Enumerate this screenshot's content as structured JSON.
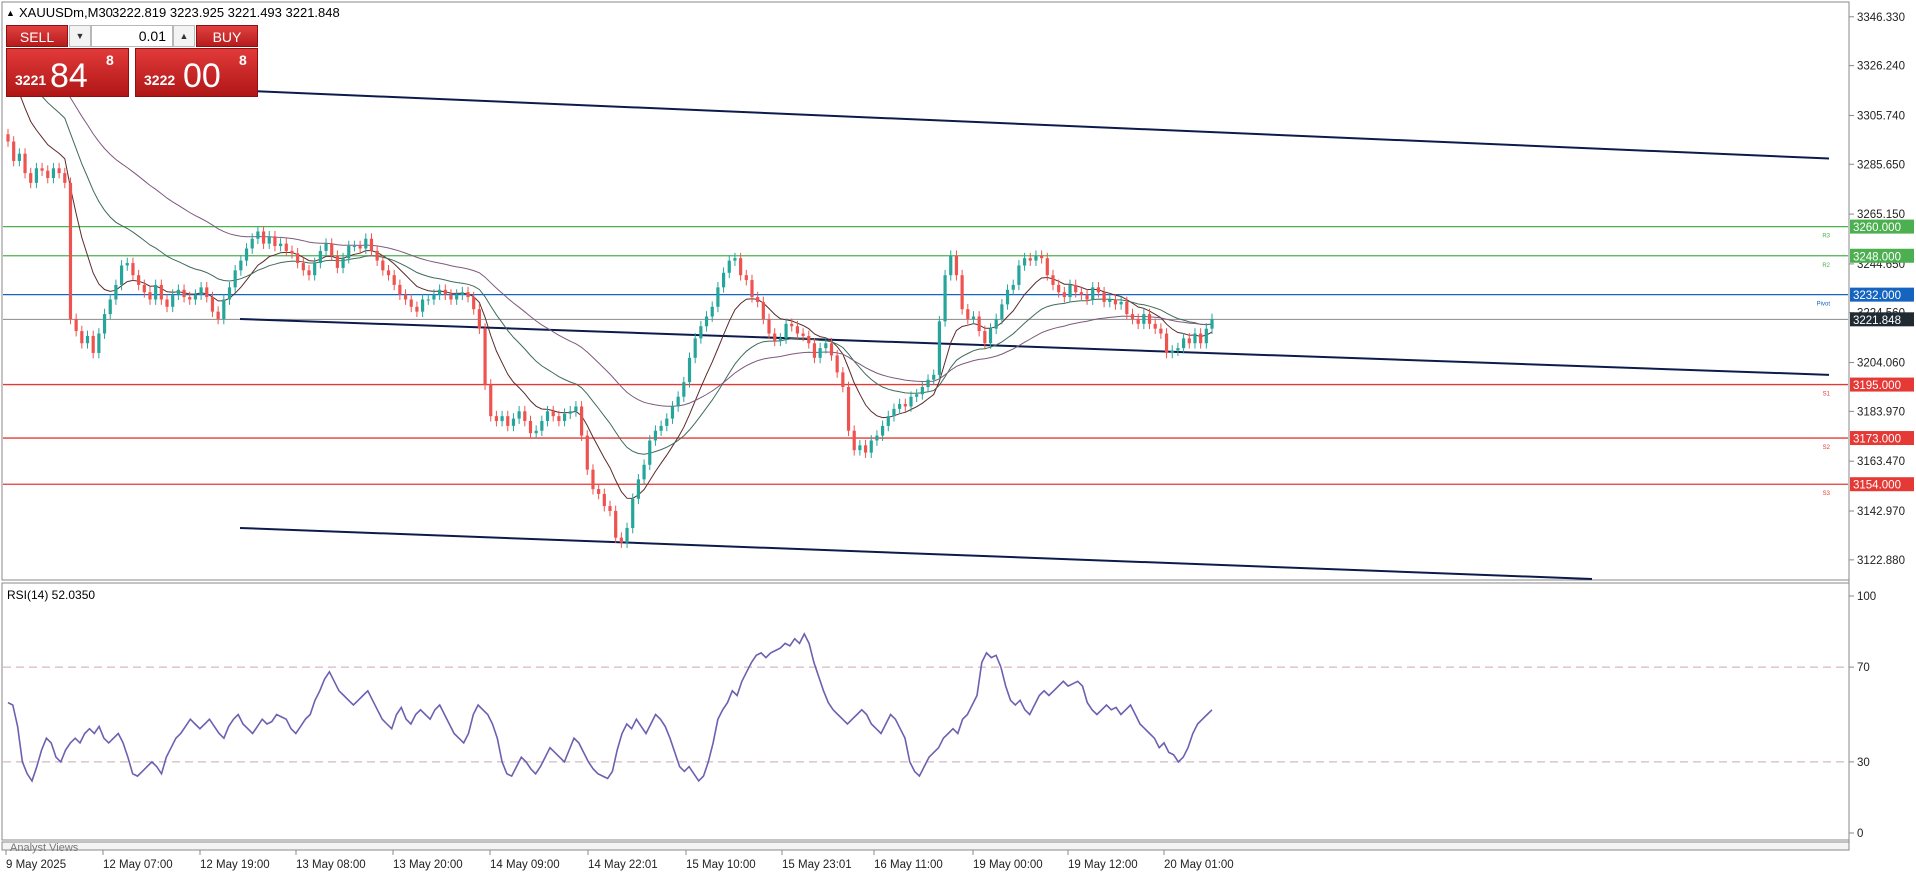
{
  "header": {
    "symbol_timeframe": "XAUUSDm,M30",
    "ohlc": "3222.819 3223.925 3221.493 3221.848"
  },
  "trade_panel": {
    "sell_label": "SELL",
    "buy_label": "BUY",
    "lot": "0.01",
    "sell_price_small": "3221",
    "sell_price_big": "84",
    "sell_price_sup": "8",
    "buy_price_small": "3222",
    "buy_price_big": "00",
    "buy_price_sup": "8"
  },
  "rsi_label": "RSI(14) 52.0350",
  "analyst_views_label": "Analyst Views",
  "colors": {
    "bull": "#26a69a",
    "bear": "#ef5350",
    "resistance": "#4caf50",
    "pivot": "#1565c0",
    "support": "#e53935",
    "channel": "#0d1b4c",
    "rsi": "#6e5fb0"
  },
  "chart_data": [
    {
      "type": "candlestick",
      "symbol": "XAUUSDm",
      "timeframe": "M30",
      "current_price": 3221.848,
      "ylim": [
        3115,
        3352
      ],
      "y_ticks": [
        "3346.330",
        "3326.240",
        "3305.740",
        "3285.650",
        "3265.150",
        "3244.650",
        "3224.560",
        "3204.060",
        "3183.970",
        "3163.470",
        "3142.970",
        "3122.880"
      ],
      "x_labels": [
        "9 May 2025",
        "12 May 07:00",
        "12 May 19:00",
        "13 May 08:00",
        "13 May 20:00",
        "14 May 09:00",
        "14 May 22:01",
        "15 May 10:00",
        "15 May 23:01",
        "16 May 11:00",
        "19 May 00:00",
        "19 May 12:00",
        "20 May 01:00"
      ],
      "horizontal_levels": [
        {
          "value": 3260.0,
          "label": "3260.000",
          "tag": "R3",
          "color": "#4caf50"
        },
        {
          "value": 3248.0,
          "label": "3248.000",
          "tag": "R2",
          "color": "#4caf50"
        },
        {
          "value": 3232.0,
          "label": "3232.000",
          "tag": "Pivot",
          "color": "#1565c0"
        },
        {
          "value": 3195.0,
          "label": "3195.000",
          "tag": "S1",
          "color": "#e53935"
        },
        {
          "value": 3173.0,
          "label": "3173.000",
          "tag": "S2",
          "color": "#e53935"
        },
        {
          "value": 3154.0,
          "label": "3154.000",
          "tag": "S3",
          "color": "#e53935"
        }
      ],
      "channel_lines": [
        {
          "from_bar": 240,
          "from": 3316,
          "to_bar": 1829,
          "to": 3288
        },
        {
          "from_bar": 240,
          "from": 3222,
          "to_bar": 1829,
          "to": 3199
        },
        {
          "from_bar": 240,
          "from": 3136,
          "to_bar": 1592,
          "to": 3115
        }
      ],
      "closes": [
        3295,
        3287,
        3290,
        3282,
        3278,
        3284,
        3283,
        3280,
        3284,
        3282,
        3278,
        3222,
        3217,
        3212,
        3215,
        3208,
        3216,
        3224,
        3230,
        3236,
        3244,
        3245,
        3240,
        3236,
        3233,
        3230,
        3236,
        3230,
        3227,
        3232,
        3234,
        3231,
        3230,
        3232,
        3235,
        3231,
        3225,
        3222,
        3230,
        3235,
        3242,
        3246,
        3251,
        3255,
        3258,
        3253,
        3256,
        3252,
        3253,
        3250,
        3249,
        3245,
        3242,
        3240,
        3245,
        3250,
        3253,
        3248,
        3243,
        3247,
        3252,
        3252,
        3251,
        3255,
        3250,
        3246,
        3242,
        3240,
        3236,
        3232,
        3230,
        3227,
        3225,
        3230,
        3230,
        3232,
        3234,
        3232,
        3230,
        3232,
        3233,
        3231,
        3226,
        3218,
        3195,
        3182,
        3180,
        3182,
        3178,
        3181,
        3184,
        3180,
        3175,
        3176,
        3180,
        3184,
        3182,
        3180,
        3183,
        3184,
        3186,
        3174,
        3160,
        3152,
        3150,
        3145,
        3143,
        3132,
        3130,
        3136,
        3148,
        3156,
        3162,
        3172,
        3176,
        3178,
        3181,
        3186,
        3190,
        3196,
        3206,
        3214,
        3219,
        3223,
        3227,
        3235,
        3241,
        3246,
        3247,
        3240,
        3238,
        3231,
        3229,
        3222,
        3216,
        3213,
        3214,
        3220,
        3219,
        3216,
        3215,
        3212,
        3206,
        3210,
        3212,
        3207,
        3200,
        3194,
        3176,
        3168,
        3170,
        3167,
        3172,
        3174,
        3178,
        3182,
        3185,
        3187,
        3186,
        3190,
        3191,
        3194,
        3197,
        3199,
        3221,
        3240,
        3248,
        3240,
        3226,
        3222,
        3223,
        3217,
        3212,
        3218,
        3222,
        3228,
        3234,
        3236,
        3244,
        3247,
        3246,
        3248,
        3247,
        3240,
        3236,
        3233,
        3231,
        3236,
        3233,
        3232,
        3230,
        3235,
        3233,
        3229,
        3230,
        3228,
        3229,
        3224,
        3222,
        3220,
        3224,
        3220,
        3218,
        3216,
        3208,
        3209,
        3210,
        3214,
        3212,
        3216,
        3212,
        3218,
        3222
      ]
    },
    {
      "type": "line",
      "name": "RSI(14)",
      "ylim": [
        0,
        100
      ],
      "y_ticks": [
        "100",
        "70",
        "30",
        "0"
      ],
      "levels": [
        70,
        30
      ],
      "current": 52.035,
      "values": [
        55,
        54,
        45,
        30,
        25,
        22,
        28,
        35,
        40,
        38,
        32,
        30,
        35,
        38,
        40,
        38,
        42,
        44,
        42,
        45,
        40,
        38,
        40,
        42,
        38,
        32,
        25,
        24,
        26,
        28,
        30,
        28,
        25,
        32,
        36,
        40,
        42,
        45,
        48,
        46,
        44,
        46,
        48,
        45,
        42,
        40,
        45,
        48,
        50,
        46,
        44,
        42,
        45,
        48,
        46,
        47,
        50,
        49,
        48,
        44,
        42,
        45,
        48,
        50,
        56,
        60,
        65,
        68,
        64,
        60,
        58,
        56,
        54,
        56,
        58,
        60,
        56,
        52,
        48,
        46,
        44,
        50,
        53,
        48,
        46,
        50,
        52,
        50,
        48,
        52,
        54,
        50,
        46,
        42,
        40,
        38,
        42,
        50,
        54,
        52,
        50,
        46,
        40,
        30,
        25,
        24,
        28,
        32,
        30,
        27,
        25,
        28,
        32,
        36,
        34,
        32,
        30,
        35,
        40,
        38,
        34,
        30,
        27,
        25,
        24,
        23,
        26,
        35,
        42,
        46,
        44,
        48,
        45,
        42,
        46,
        50,
        48,
        45,
        40,
        34,
        28,
        26,
        28,
        25,
        22,
        24,
        30,
        38,
        48,
        52,
        55,
        60,
        58,
        64,
        68,
        72,
        75,
        76,
        74,
        76,
        77,
        78,
        80,
        79,
        82,
        80,
        84,
        80,
        72,
        66,
        60,
        55,
        52,
        50,
        48,
        46,
        48,
        50,
        52,
        50,
        46,
        44,
        42,
        46,
        50,
        48,
        44,
        40,
        30,
        26,
        24,
        28,
        32,
        34,
        36,
        40,
        42,
        44,
        42,
        48,
        50,
        54,
        58,
        72,
        76,
        74,
        75,
        70,
        62,
        56,
        54,
        56,
        52,
        50,
        54,
        58,
        60,
        58,
        60,
        62,
        64,
        62,
        63,
        64,
        62,
        55,
        52,
        50,
        52,
        54,
        52,
        53,
        50,
        52,
        54,
        50,
        46,
        44,
        42,
        40,
        36,
        38,
        34,
        33,
        30,
        32,
        36,
        42,
        46,
        48,
        50,
        52
      ]
    }
  ]
}
